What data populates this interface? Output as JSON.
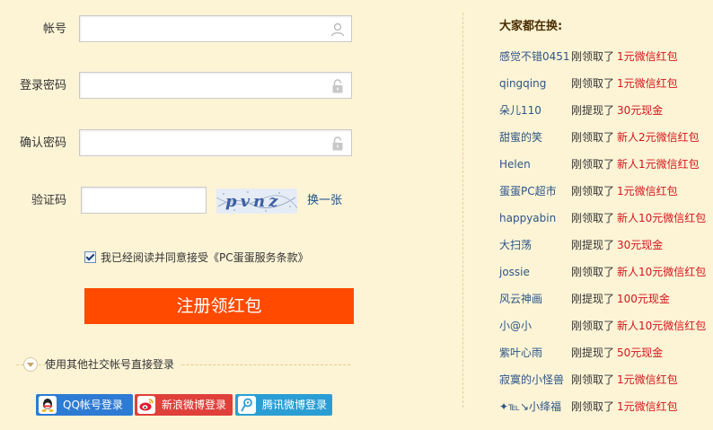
{
  "form": {
    "account_label": "帐号",
    "password_label": "登录密码",
    "confirm_label": "确认密码",
    "captcha_label": "验证码",
    "captcha_text": "pvnz",
    "refresh_label": "换一张",
    "agree_text": "我已经阅读并同意接受",
    "agree_link": "《PC蛋蛋服务条款》",
    "submit_label": "注册领红包",
    "social_prompt": "使用其他社交帐号直接登录",
    "qq_label": "QQ帐号登录",
    "weibo_label": "新浪微博登录",
    "tqq_label": "腾讯微博登录"
  },
  "colors": {
    "background": "#fdf4d6",
    "submit": "#ff4a00",
    "prize": "#d3141a",
    "username": "#2c5586",
    "qq": "#2e7bd4",
    "weibo": "#e0403a",
    "tqq": "#2a9ed4"
  },
  "sidebar": {
    "title": "大家都在换:",
    "items": [
      {
        "user": "感觉不错0451",
        "action": "刚领取了",
        "prize": "1元微信红包"
      },
      {
        "user": "qingqing",
        "action": "刚领取了",
        "prize": "1元微信红包"
      },
      {
        "user": "朵儿110",
        "action": "刚提现了",
        "prize": "30元现金"
      },
      {
        "user": "甜蜜的笑",
        "action": "刚领取了",
        "prize": "新人2元微信红包"
      },
      {
        "user": "Helen",
        "action": "刚领取了",
        "prize": "新人1元微信红包"
      },
      {
        "user": "蛋蛋PC超市",
        "action": "刚领取了",
        "prize": "1元微信红包"
      },
      {
        "user": "happyabin",
        "action": "刚领取了",
        "prize": "新人10元微信红包"
      },
      {
        "user": "大扫荡",
        "action": "刚提现了",
        "prize": "30元现金"
      },
      {
        "user": "jossie",
        "action": "刚领取了",
        "prize": "新人10元微信红包"
      },
      {
        "user": "风云神画",
        "action": "刚提现了",
        "prize": "100元现金"
      },
      {
        "user": "小@小",
        "action": "刚领取了",
        "prize": "新人10元微信红包"
      },
      {
        "user": "紫叶心雨",
        "action": "刚提现了",
        "prize": "50元现金"
      },
      {
        "user": "寂寞的小怪兽",
        "action": "刚领取了",
        "prize": "1元微信红包"
      },
      {
        "user": "✦℡↘小绛福",
        "action": "刚领取了",
        "prize": "1元微信红包"
      }
    ]
  }
}
